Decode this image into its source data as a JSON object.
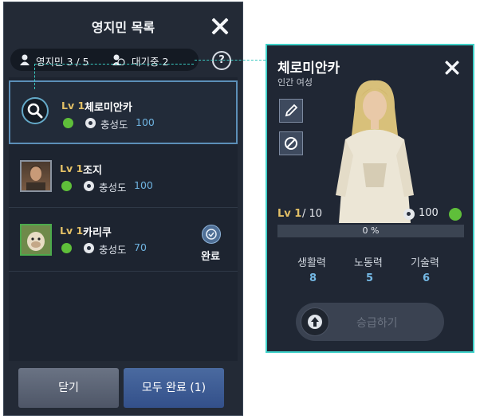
{
  "left_panel": {
    "title": "영지민 목록",
    "residents_label": "영지민 3 / 5",
    "waiting_label": "대기중 2",
    "help_label": "?",
    "items": [
      {
        "level": "Lv 1",
        "name": "체로미안카",
        "loyalty_label": "충성도",
        "loyalty": "100"
      },
      {
        "level": "Lv 1",
        "name": "조지",
        "loyalty_label": "충성도",
        "loyalty": "100"
      },
      {
        "level": "Lv 1",
        "name": "카리쿠",
        "loyalty_label": "충성도",
        "loyalty": "70",
        "status": "완료"
      }
    ],
    "close_button": "닫기",
    "complete_all_button": "모두 완료 (1)"
  },
  "detail_panel": {
    "name": "체로미안카",
    "subtitle": "인간 여성",
    "level_label": "Lv 1",
    "level_max": "/ 10",
    "loyalty": "100",
    "progress_percent": 0,
    "progress_label": "0 %",
    "stats": [
      {
        "label": "생활력",
        "value": "8"
      },
      {
        "label": "노동력",
        "value": "5"
      },
      {
        "label": "기술력",
        "value": "6"
      }
    ],
    "upgrade_button": "승급하기"
  },
  "colors": {
    "accent": "#3fd1c9",
    "gold": "#e3c066",
    "value_blue": "#6fb3e0",
    "smile_green": "#5fbf3a"
  }
}
